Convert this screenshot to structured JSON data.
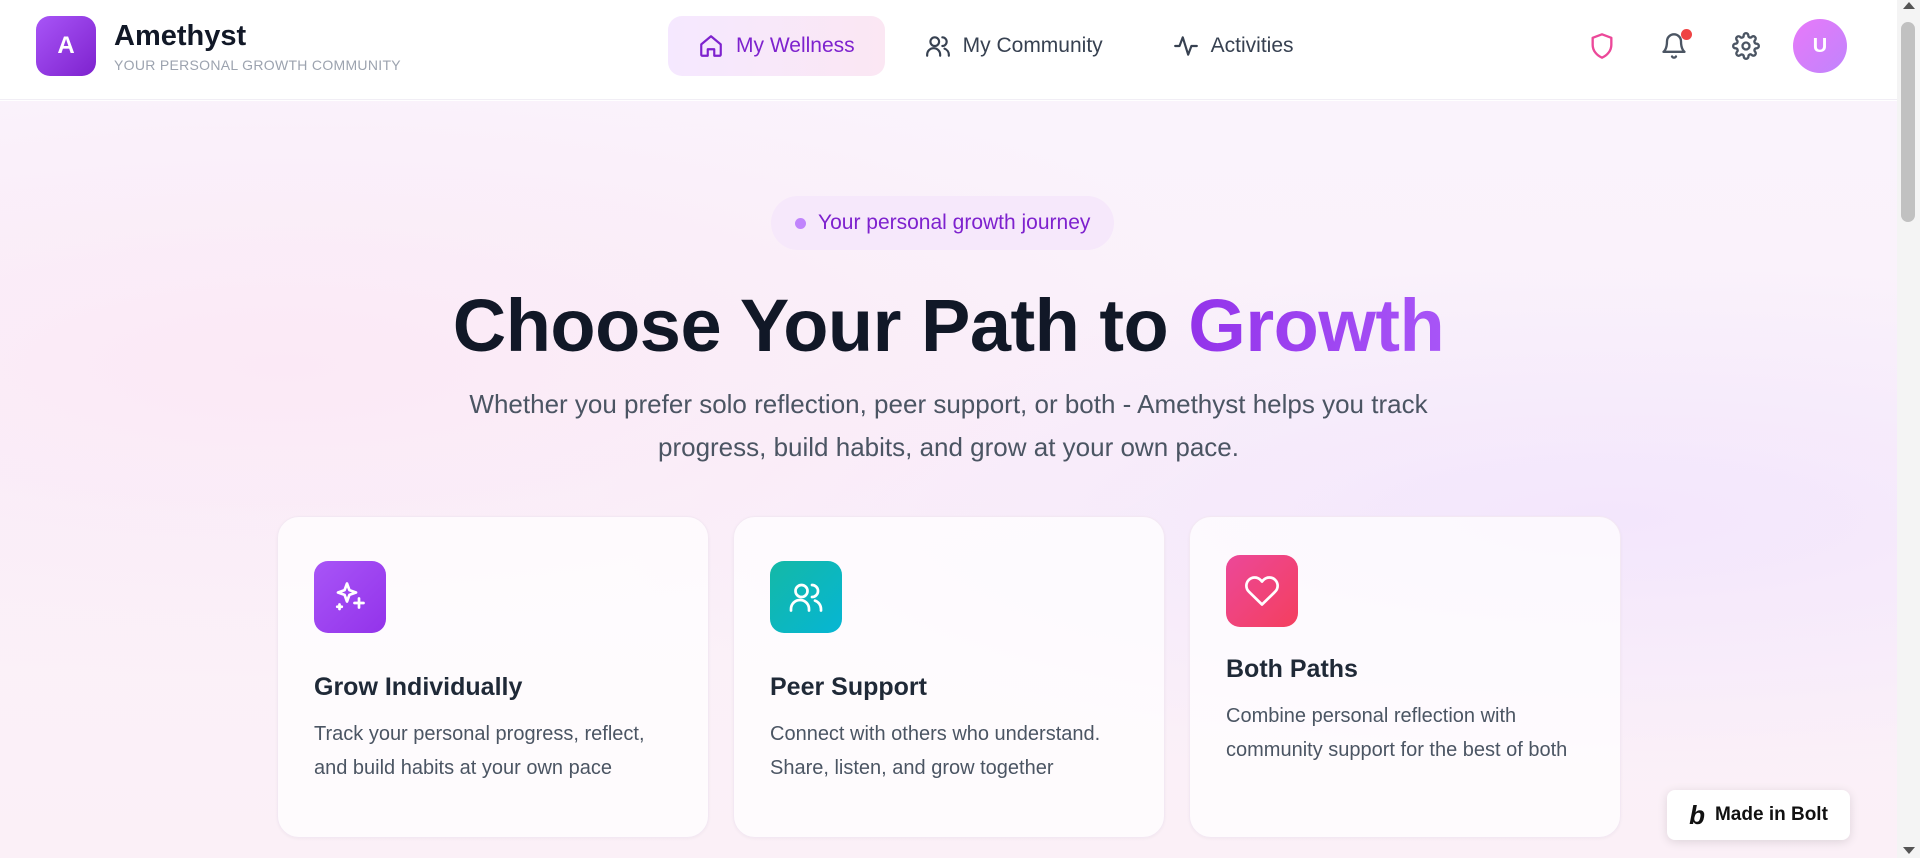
{
  "brand": {
    "logo_letter": "A",
    "name": "Amethyst",
    "tagline": "YOUR PERSONAL GROWTH COMMUNITY"
  },
  "nav": [
    {
      "label": "My Wellness",
      "icon": "home-icon",
      "active": true
    },
    {
      "label": "My Community",
      "icon": "users-icon",
      "active": false
    },
    {
      "label": "Activities",
      "icon": "activity-icon",
      "active": false
    }
  ],
  "header_icons": {
    "shield": "shield-icon",
    "bell": "bell-icon",
    "settings": "gear-icon",
    "avatar_letter": "U"
  },
  "hero": {
    "pill_text": "Your personal growth journey",
    "title_main": "Choose Your Path to ",
    "title_accent": "Growth",
    "subtitle": "Whether you prefer solo reflection, peer support, or both - Amethyst helps you track progress, build habits, and grow at your own pace."
  },
  "cards": [
    {
      "title": "Grow Individually",
      "description": "Track your personal progress, reflect, and build habits at your own pace",
      "icon": "sparkles-icon",
      "color": "#9333ea"
    },
    {
      "title": "Peer Support",
      "description": "Connect with others who understand. Share, listen, and grow together",
      "icon": "users-icon",
      "color": "#14b8a6"
    },
    {
      "title": "Both Paths",
      "description": "Combine personal reflection with community support for the best of both",
      "icon": "heart-icon",
      "color": "#f43f5e"
    }
  ],
  "badge": {
    "label": "Made in Bolt",
    "letter": "b"
  },
  "colors": {
    "accent": "#9333ea",
    "teal": "#14b8a6",
    "rose": "#f43f5e",
    "notification": "#ef4444"
  }
}
